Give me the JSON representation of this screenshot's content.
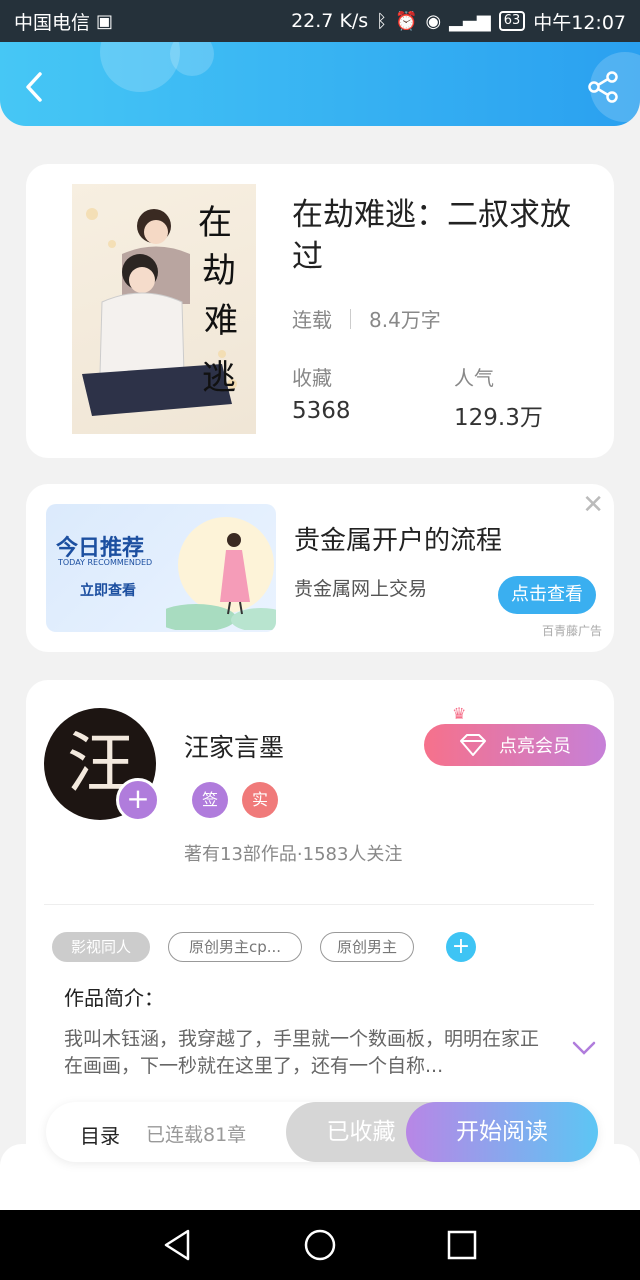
{
  "status_bar": {
    "carrier": "中国电信",
    "speed": "22.7 K/s",
    "battery": "63",
    "time": "中午12:07"
  },
  "header": {
    "back_icon": "back-arrow-icon",
    "share_icon": "share-icon"
  },
  "book": {
    "title": "在劫难逃：二叔求放过",
    "status": "连载",
    "word_count": "8.4万字",
    "favorites_label": "收藏",
    "favorites_value": "5368",
    "popularity_label": "人气",
    "popularity_value": "129.3万"
  },
  "ad": {
    "banner_title": "今日推荐",
    "banner_sub": "TODAY RECOMMENDED",
    "banner_cta": "立即查看",
    "title": "贵金属开户的流程",
    "subtitle": "贵金属网上交易",
    "button": "点击查看",
    "source": "百青藤广告",
    "close_icon": "close-icon"
  },
  "author": {
    "avatar_char": "汪",
    "name": "汪家言墨",
    "badge_sign": "签",
    "badge_real": "实",
    "info": "著有13部作品·1583人关注",
    "vip_button": "点亮会员"
  },
  "tags": [
    "影视同人",
    "原创男主cp...",
    "原创男主"
  ],
  "intro": {
    "label": "作品简介：",
    "text": "我叫木钰涵，我穿越了，手里就一个数画板，明明在家正在画画，下一秒就在这里了，还有一个自称..."
  },
  "action_bar": {
    "toc_label": "目录",
    "toc_count": "已连载81章",
    "collected": "已收藏",
    "start_reading": "开始阅读"
  },
  "colors": {
    "header_start": "#46c7f5",
    "header_end": "#2aa0f0",
    "accent_blue": "#3aaff0",
    "vip_pink": "#f6718b",
    "vip_purple": "#c680d8"
  }
}
